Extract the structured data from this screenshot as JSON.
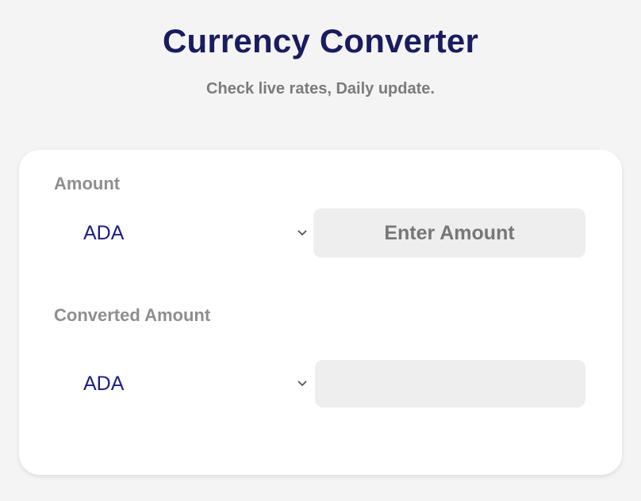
{
  "header": {
    "title": "Currency Converter",
    "subtitle": "Check live rates, Daily update."
  },
  "converter": {
    "amount_label": "Amount",
    "from_currency": "ADA",
    "amount_placeholder": "Enter Amount",
    "amount_value": "",
    "converted_label": "Converted Amount",
    "to_currency": "ADA",
    "converted_value": ""
  },
  "icons": {
    "dropdown": "chevron-down-icon"
  },
  "colors": {
    "title": "#191c5e",
    "currency_text": "#1c1c86",
    "label_gray": "#8e8e8e",
    "input_bg": "#eeeeee",
    "page_bg": "#f4f4f5",
    "card_bg": "#ffffff"
  }
}
